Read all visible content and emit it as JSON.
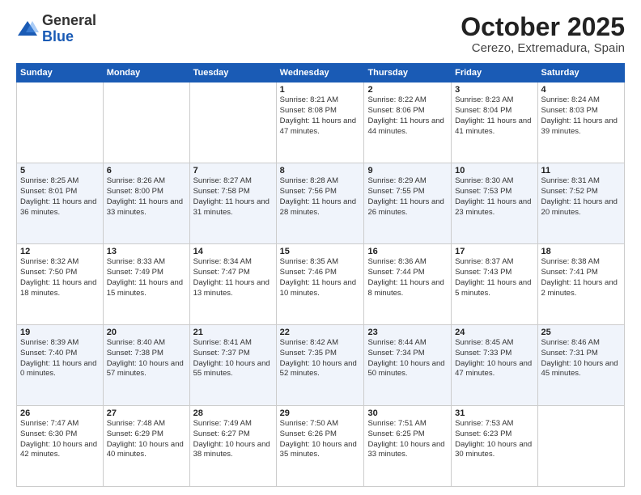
{
  "header": {
    "logo_general": "General",
    "logo_blue": "Blue",
    "month": "October 2025",
    "location": "Cerezo, Extremadura, Spain"
  },
  "weekdays": [
    "Sunday",
    "Monday",
    "Tuesday",
    "Wednesday",
    "Thursday",
    "Friday",
    "Saturday"
  ],
  "weeks": [
    [
      {
        "day": "",
        "info": ""
      },
      {
        "day": "",
        "info": ""
      },
      {
        "day": "",
        "info": ""
      },
      {
        "day": "1",
        "info": "Sunrise: 8:21 AM\nSunset: 8:08 PM\nDaylight: 11 hours and 47 minutes."
      },
      {
        "day": "2",
        "info": "Sunrise: 8:22 AM\nSunset: 8:06 PM\nDaylight: 11 hours and 44 minutes."
      },
      {
        "day": "3",
        "info": "Sunrise: 8:23 AM\nSunset: 8:04 PM\nDaylight: 11 hours and 41 minutes."
      },
      {
        "day": "4",
        "info": "Sunrise: 8:24 AM\nSunset: 8:03 PM\nDaylight: 11 hours and 39 minutes."
      }
    ],
    [
      {
        "day": "5",
        "info": "Sunrise: 8:25 AM\nSunset: 8:01 PM\nDaylight: 11 hours and 36 minutes."
      },
      {
        "day": "6",
        "info": "Sunrise: 8:26 AM\nSunset: 8:00 PM\nDaylight: 11 hours and 33 minutes."
      },
      {
        "day": "7",
        "info": "Sunrise: 8:27 AM\nSunset: 7:58 PM\nDaylight: 11 hours and 31 minutes."
      },
      {
        "day": "8",
        "info": "Sunrise: 8:28 AM\nSunset: 7:56 PM\nDaylight: 11 hours and 28 minutes."
      },
      {
        "day": "9",
        "info": "Sunrise: 8:29 AM\nSunset: 7:55 PM\nDaylight: 11 hours and 26 minutes."
      },
      {
        "day": "10",
        "info": "Sunrise: 8:30 AM\nSunset: 7:53 PM\nDaylight: 11 hours and 23 minutes."
      },
      {
        "day": "11",
        "info": "Sunrise: 8:31 AM\nSunset: 7:52 PM\nDaylight: 11 hours and 20 minutes."
      }
    ],
    [
      {
        "day": "12",
        "info": "Sunrise: 8:32 AM\nSunset: 7:50 PM\nDaylight: 11 hours and 18 minutes."
      },
      {
        "day": "13",
        "info": "Sunrise: 8:33 AM\nSunset: 7:49 PM\nDaylight: 11 hours and 15 minutes."
      },
      {
        "day": "14",
        "info": "Sunrise: 8:34 AM\nSunset: 7:47 PM\nDaylight: 11 hours and 13 minutes."
      },
      {
        "day": "15",
        "info": "Sunrise: 8:35 AM\nSunset: 7:46 PM\nDaylight: 11 hours and 10 minutes."
      },
      {
        "day": "16",
        "info": "Sunrise: 8:36 AM\nSunset: 7:44 PM\nDaylight: 11 hours and 8 minutes."
      },
      {
        "day": "17",
        "info": "Sunrise: 8:37 AM\nSunset: 7:43 PM\nDaylight: 11 hours and 5 minutes."
      },
      {
        "day": "18",
        "info": "Sunrise: 8:38 AM\nSunset: 7:41 PM\nDaylight: 11 hours and 2 minutes."
      }
    ],
    [
      {
        "day": "19",
        "info": "Sunrise: 8:39 AM\nSunset: 7:40 PM\nDaylight: 11 hours and 0 minutes."
      },
      {
        "day": "20",
        "info": "Sunrise: 8:40 AM\nSunset: 7:38 PM\nDaylight: 10 hours and 57 minutes."
      },
      {
        "day": "21",
        "info": "Sunrise: 8:41 AM\nSunset: 7:37 PM\nDaylight: 10 hours and 55 minutes."
      },
      {
        "day": "22",
        "info": "Sunrise: 8:42 AM\nSunset: 7:35 PM\nDaylight: 10 hours and 52 minutes."
      },
      {
        "day": "23",
        "info": "Sunrise: 8:44 AM\nSunset: 7:34 PM\nDaylight: 10 hours and 50 minutes."
      },
      {
        "day": "24",
        "info": "Sunrise: 8:45 AM\nSunset: 7:33 PM\nDaylight: 10 hours and 47 minutes."
      },
      {
        "day": "25",
        "info": "Sunrise: 8:46 AM\nSunset: 7:31 PM\nDaylight: 10 hours and 45 minutes."
      }
    ],
    [
      {
        "day": "26",
        "info": "Sunrise: 7:47 AM\nSunset: 6:30 PM\nDaylight: 10 hours and 42 minutes."
      },
      {
        "day": "27",
        "info": "Sunrise: 7:48 AM\nSunset: 6:29 PM\nDaylight: 10 hours and 40 minutes."
      },
      {
        "day": "28",
        "info": "Sunrise: 7:49 AM\nSunset: 6:27 PM\nDaylight: 10 hours and 38 minutes."
      },
      {
        "day": "29",
        "info": "Sunrise: 7:50 AM\nSunset: 6:26 PM\nDaylight: 10 hours and 35 minutes."
      },
      {
        "day": "30",
        "info": "Sunrise: 7:51 AM\nSunset: 6:25 PM\nDaylight: 10 hours and 33 minutes."
      },
      {
        "day": "31",
        "info": "Sunrise: 7:53 AM\nSunset: 6:23 PM\nDaylight: 10 hours and 30 minutes."
      },
      {
        "day": "",
        "info": ""
      }
    ]
  ]
}
